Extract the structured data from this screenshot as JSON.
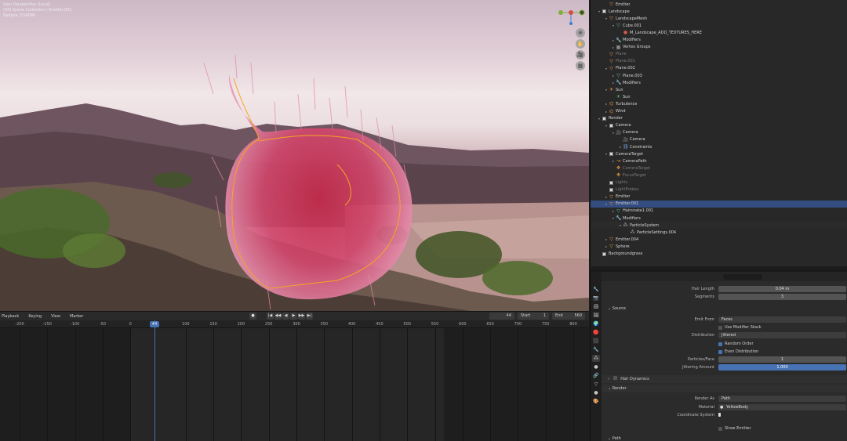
{
  "viewport": {
    "info": [
      "User Perspective (Local)",
      "(44) Scene Collection | Emitter.001",
      "Sample 32/4096"
    ],
    "gizmo_axes": [
      "X",
      "Y",
      "Z"
    ],
    "buttons": [
      "⊕",
      "✋",
      "🎥",
      "▦"
    ]
  },
  "timeline": {
    "menus": [
      "Playback",
      "Keying",
      "View",
      "Marker"
    ],
    "controls": [
      "●",
      "|◀",
      "◀◀",
      "◀",
      "▶",
      "▶▶",
      "▶|"
    ],
    "current_frame": "44",
    "start_label": "Start",
    "start_value": "1",
    "end_label": "End",
    "end_value": "560",
    "ticks": [
      "-200",
      "-150",
      "-100",
      "-50",
      "0",
      "44",
      "100",
      "150",
      "200",
      "250",
      "300",
      "350",
      "400",
      "450",
      "500",
      "550",
      "600",
      "650",
      "700",
      "750",
      "800"
    ]
  },
  "outliner": {
    "rows": [
      {
        "label": "Emitter",
        "depth": 1,
        "icon": "▽",
        "color": "#e89a3c",
        "arrow": ""
      },
      {
        "label": "Landscape",
        "depth": 0,
        "icon": "▣",
        "color": "#dddddd",
        "arrow": "▾"
      },
      {
        "label": "LandscapeMesh",
        "depth": 1,
        "icon": "▽",
        "color": "#e89a3c",
        "arrow": "▾"
      },
      {
        "label": "Cube.001",
        "depth": 2,
        "icon": "▽",
        "color": "#57c98a",
        "arrow": "▾"
      },
      {
        "label": "M_Landscape_ADD_TEXTURES_HERE",
        "depth": 3,
        "icon": "●",
        "color": "#d2574f",
        "arrow": ""
      },
      {
        "label": "Modifiers",
        "depth": 2,
        "icon": "🔧",
        "color": "#6e9ad6",
        "arrow": "▸"
      },
      {
        "label": "Vertex Groups",
        "depth": 2,
        "icon": "▦",
        "color": "#aaaaaa",
        "arrow": "▸"
      },
      {
        "label": "Plane",
        "depth": 1,
        "icon": "▽",
        "color": "#e89a3c",
        "arrow": "",
        "dim": true
      },
      {
        "label": "Plane.001",
        "depth": 1,
        "icon": "▽",
        "color": "#e89a3c",
        "arrow": "",
        "dim": true
      },
      {
        "label": "Plane.002",
        "depth": 1,
        "icon": "▽",
        "color": "#e89a3c",
        "arrow": "▾"
      },
      {
        "label": "Plane.003",
        "depth": 2,
        "icon": "▽",
        "color": "#57c98a",
        "arrow": "▸"
      },
      {
        "label": "Modifiers",
        "depth": 2,
        "icon": "🔧",
        "color": "#6e9ad6",
        "arrow": "▸"
      },
      {
        "label": "Sun",
        "depth": 1,
        "icon": "☀",
        "color": "#e89a3c",
        "arrow": "▾"
      },
      {
        "label": "Sun",
        "depth": 2,
        "icon": "☀",
        "color": "#57c98a",
        "arrow": ""
      },
      {
        "label": "Turbulence",
        "depth": 1,
        "icon": "⌬",
        "color": "#e89a3c",
        "arrow": "▸"
      },
      {
        "label": "Wind",
        "depth": 1,
        "icon": "⌬",
        "color": "#e89a3c",
        "arrow": "▸"
      },
      {
        "label": "Render",
        "depth": 0,
        "icon": "▣",
        "color": "#dddddd",
        "arrow": "▾"
      },
      {
        "label": "Camera",
        "depth": 1,
        "icon": "▣",
        "color": "#dddddd",
        "arrow": "▾"
      },
      {
        "label": "Camera",
        "depth": 2,
        "icon": "🎥",
        "color": "#e89a3c",
        "arrow": "▾"
      },
      {
        "label": "Camera",
        "depth": 3,
        "icon": "🎥",
        "color": "#57c98a",
        "arrow": ""
      },
      {
        "label": "Constraints",
        "depth": 3,
        "icon": "⛓",
        "color": "#6e9ad6",
        "arrow": "▸"
      },
      {
        "label": "CameraTarget",
        "depth": 1,
        "icon": "▣",
        "color": "#dddddd",
        "arrow": "▾"
      },
      {
        "label": "CameraPath",
        "depth": 2,
        "icon": "↝",
        "color": "#e89a3c",
        "arrow": "▸"
      },
      {
        "label": "CameraTarget",
        "depth": 2,
        "icon": "✥",
        "color": "#e89a3c",
        "arrow": "",
        "dim": true
      },
      {
        "label": "FocusTarget",
        "depth": 2,
        "icon": "✥",
        "color": "#e89a3c",
        "arrow": "",
        "dim": true
      },
      {
        "label": "Lights",
        "depth": 1,
        "icon": "▣",
        "color": "#dddddd",
        "arrow": "",
        "dim": true
      },
      {
        "label": "LightProbes",
        "depth": 1,
        "icon": "▣",
        "color": "#dddddd",
        "arrow": "",
        "dim": true
      },
      {
        "label": "Emitter",
        "depth": 1,
        "icon": "▽",
        "color": "#e89a3c",
        "arrow": "▸"
      },
      {
        "label": "Emitter.001",
        "depth": 1,
        "icon": "▽",
        "color": "#e89a3c",
        "arrow": "▾",
        "sel": true
      },
      {
        "label": "Hairsnake1.001",
        "depth": 2,
        "icon": "▽",
        "color": "#57c98a",
        "arrow": "▸"
      },
      {
        "label": "Modifiers",
        "depth": 2,
        "icon": "🔧",
        "color": "#6e9ad6",
        "arrow": "▾"
      },
      {
        "label": "ParticleSystem",
        "depth": 3,
        "icon": "⁂",
        "color": "#aaaaaa",
        "arrow": "▾",
        "alt": true
      },
      {
        "label": "ParticleSettings.004",
        "depth": 4,
        "icon": "⁂",
        "color": "#aaaaaa",
        "arrow": ""
      },
      {
        "label": "Emitter.004",
        "depth": 1,
        "icon": "▽",
        "color": "#e89a3c",
        "arrow": "▸"
      },
      {
        "label": "Sphere",
        "depth": 1,
        "icon": "▽",
        "color": "#e89a3c",
        "arrow": "▸"
      },
      {
        "label": "Backgroundgrass",
        "depth": 0,
        "icon": "▣",
        "color": "#dddddd",
        "arrow": ""
      }
    ]
  },
  "properties": {
    "search_placeholder": "",
    "tabs": [
      "🔧",
      "📷",
      "🖨",
      "🖼",
      "🌍",
      "🔴",
      "⬛",
      "🔧",
      "⁂",
      "●",
      "🔗",
      "▽",
      "●",
      "🎨"
    ],
    "hair_length_label": "Hair Length",
    "hair_length_value": "0.04 m",
    "segments_label": "Segments",
    "segments_value": "3",
    "source_label": "Source",
    "emit_from_label": "Emit From",
    "emit_from_value": "Faces",
    "use_modifier_stack": "Use Modifier Stack",
    "distribution_label": "Distribution",
    "distribution_value": "Jittered",
    "random_order": "Random Order",
    "even_distribution": "Even Distribution",
    "particles_face_label": "Particles/Face",
    "particles_face_value": "1",
    "jittering_label": "Jittering Amount",
    "jittering_value": "1.000",
    "hair_dynamics": "Hair Dynamics",
    "render_section": "Render",
    "render_as_label": "Render As",
    "render_as_value": "Path",
    "material_label": "Material",
    "material_value": "YellowBody",
    "coord_system_label": "Coordinate System",
    "show_emitter": "Show Emitter",
    "path_section": "Path"
  }
}
